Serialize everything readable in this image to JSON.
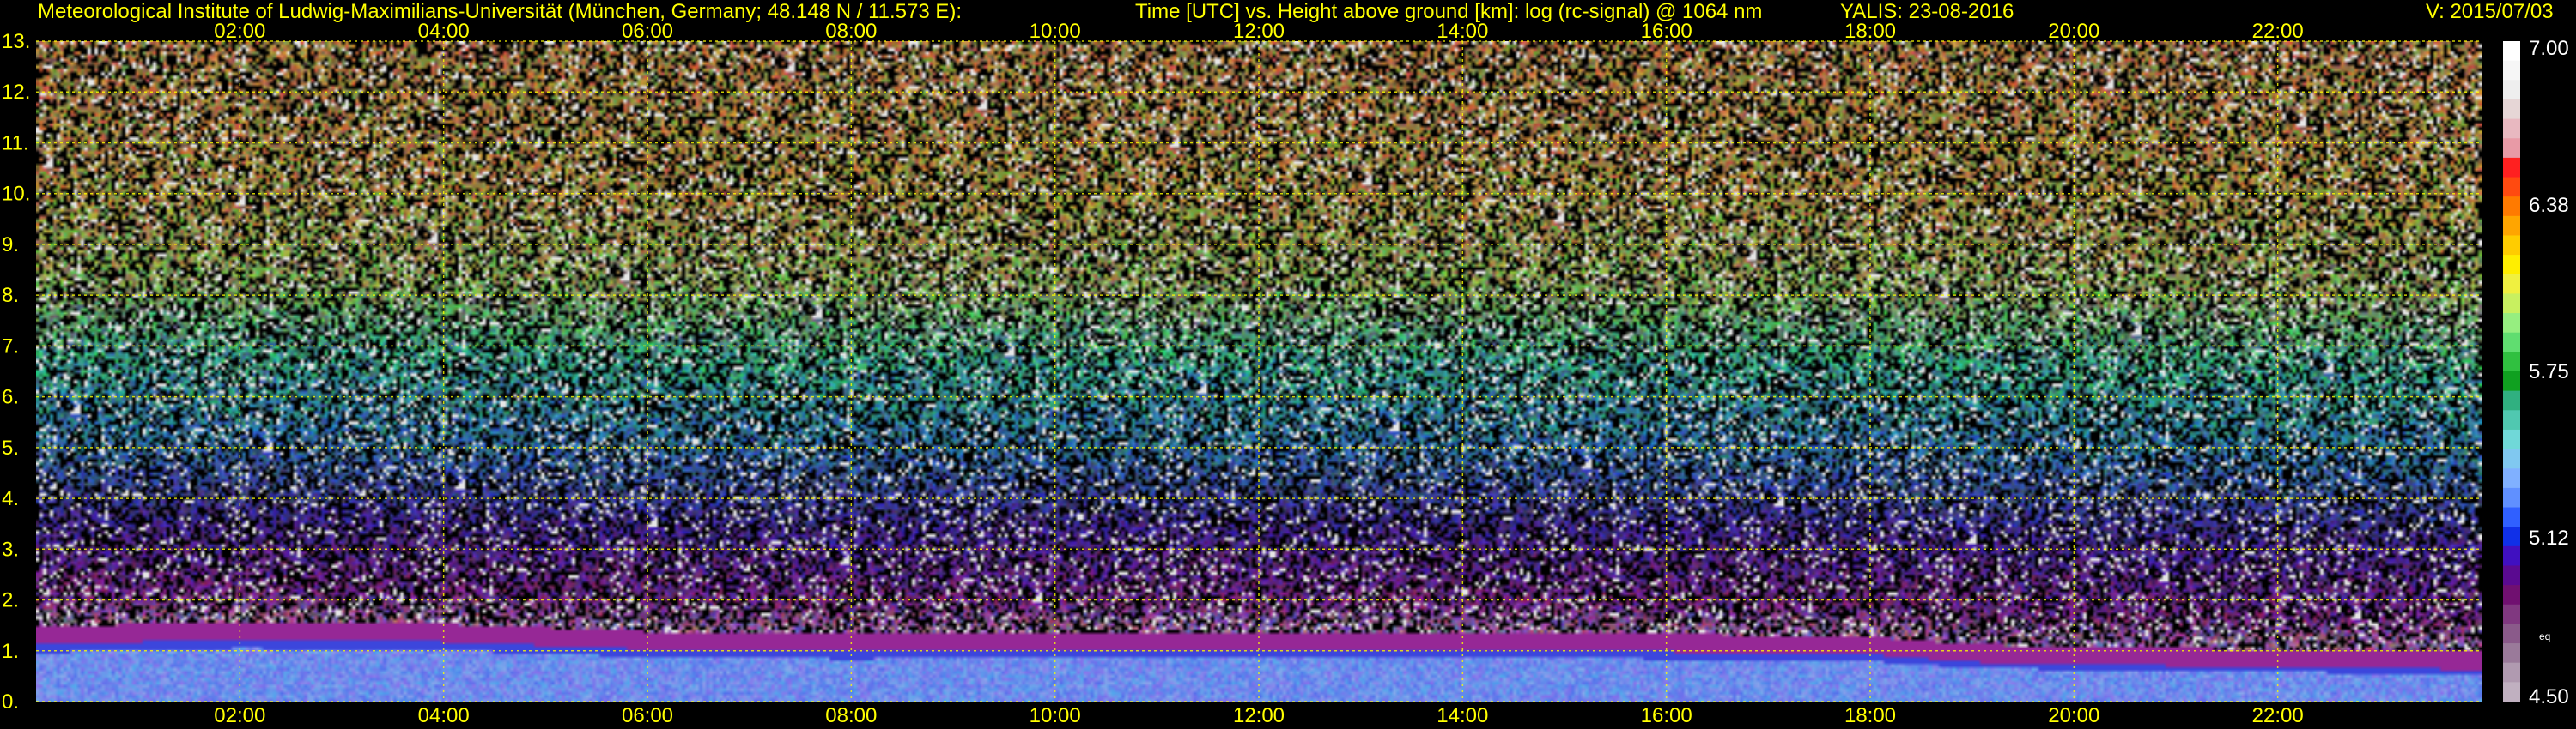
{
  "header": {
    "institute": "Meteorological Institute of Ludwig-Maximilians-Universität (München, Germany; 48.148 N / 11.573 E):",
    "description": "Time [UTC] vs. Height above ground [km]: log (rc-signal) @ 1064 nm",
    "instrument": "YALIS: 23-08-2016",
    "version": "V: 2015/07/03"
  },
  "colors": {
    "text": "#ffff00",
    "background": "#000000",
    "grid": "#ffff00"
  },
  "chart_data": {
    "type": "heatmap",
    "title": "Time [UTC] vs. Height above ground [km]: log (rc-signal) @ 1064 nm",
    "xlabel": "",
    "ylabel": "",
    "x_unit": "hours UTC",
    "xlim": [
      0,
      24
    ],
    "x_ticks": [
      "02:00",
      "04:00",
      "06:00",
      "08:00",
      "10:00",
      "12:00",
      "14:00",
      "16:00",
      "18:00",
      "20:00",
      "22:00"
    ],
    "x_tick_values": [
      2,
      4,
      6,
      8,
      10,
      12,
      14,
      16,
      18,
      20,
      22
    ],
    "ylim": [
      0,
      13
    ],
    "y_ticks": [
      "0.",
      "1.",
      "2.",
      "3.",
      "4.",
      "5.",
      "6.",
      "7.",
      "8.",
      "9.",
      "10.",
      "11.",
      "12.",
      "13."
    ],
    "y_tick_values": [
      0,
      1,
      2,
      3,
      4,
      5,
      6,
      7,
      8,
      9,
      10,
      11,
      12,
      13
    ],
    "grid": true,
    "colorbar": {
      "range": [
        4.5,
        7.0
      ],
      "labels": [
        "7.00",
        "6.38",
        "5.75",
        "5.12",
        "4.50"
      ],
      "label_values": [
        7.0,
        6.38,
        5.75,
        5.12,
        4.5
      ],
      "extra_label": "eq"
    },
    "boundary_layer_top_km": {
      "times_h": [
        0,
        2,
        4,
        6,
        8,
        10,
        12,
        14,
        16,
        18,
        19,
        20,
        22,
        24
      ],
      "heights": [
        1.1,
        1.2,
        1.15,
        1.0,
        0.95,
        1.0,
        1.0,
        1.0,
        0.95,
        0.9,
        0.75,
        0.7,
        0.65,
        0.6
      ]
    }
  }
}
